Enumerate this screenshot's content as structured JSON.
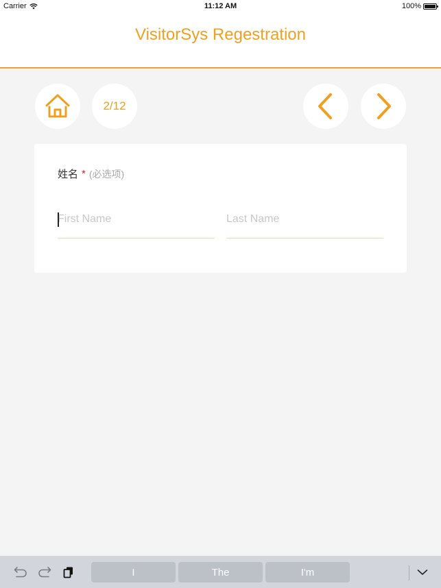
{
  "status_bar": {
    "carrier": "Carrier",
    "time": "11:12 AM",
    "battery": "100%",
    "wifi_icon": "wifi-icon",
    "battery_icon": "battery-icon"
  },
  "header": {
    "title": "VisitorSys Regestration",
    "accent_color": "#f0a020"
  },
  "nav": {
    "home_icon": "home-icon",
    "page_indicator": "2/12",
    "prev_icon": "chevron-left-icon",
    "next_icon": "chevron-right-icon"
  },
  "form": {
    "field_label": "姓名",
    "required_mark": "*",
    "required_hint": "(必选项)",
    "first_name": {
      "value": "",
      "placeholder": "First Name"
    },
    "last_name": {
      "value": "",
      "placeholder": "Last Name"
    }
  },
  "keyboard_bar": {
    "undo_icon": "undo-icon",
    "redo_icon": "redo-icon",
    "paste_icon": "paste-icon",
    "suggestions": [
      "I",
      "The",
      "I'm"
    ],
    "dismiss_icon": "chevron-down-icon"
  }
}
